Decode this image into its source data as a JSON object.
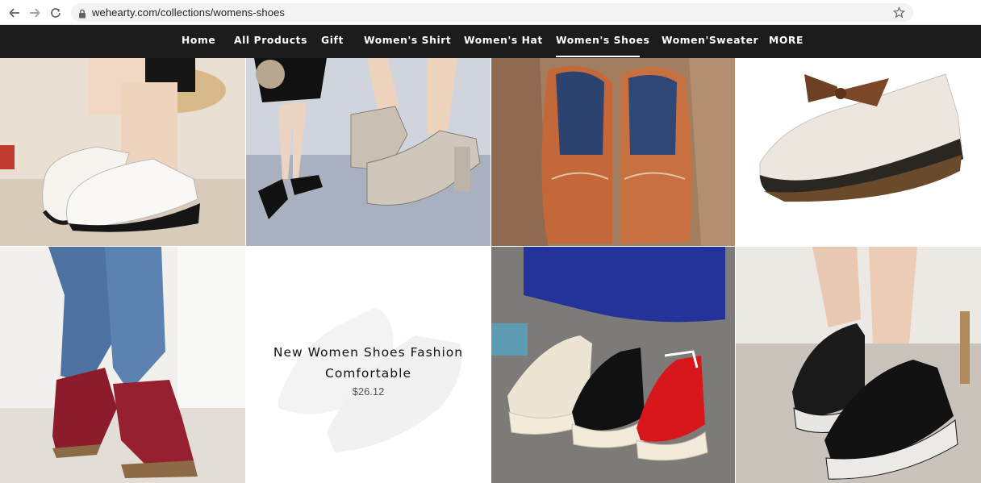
{
  "browser": {
    "url": "wehearty.com/collections/womens-shoes",
    "icons": [
      "back-icon",
      "forward-icon",
      "reload-icon",
      "lock-icon",
      "star-icon"
    ]
  },
  "nav": {
    "items": [
      "Home",
      "All Products",
      "Gift",
      "Women's Shirt",
      "Women's Hat",
      "Women's Shoes",
      "Women'Sweater",
      "MORE"
    ],
    "active": "Women's Shoes"
  },
  "featured_product": {
    "title_line1": "New Women Shoes Fashion",
    "title_line2": "Comfortable",
    "price": "$26.12"
  },
  "colors": {
    "nav_bg": "#1c1c1c",
    "nav_text": "#ffffff"
  }
}
